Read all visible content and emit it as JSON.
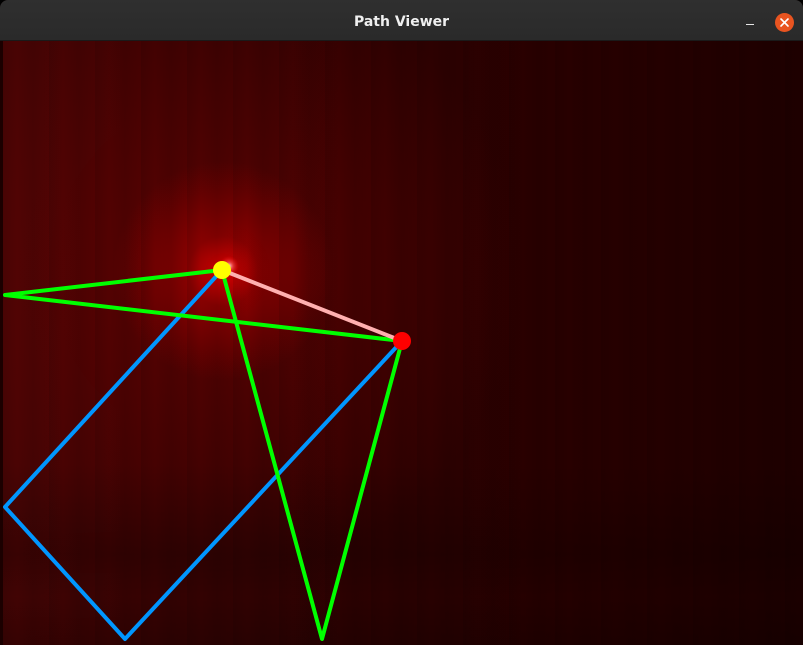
{
  "window": {
    "title": "Path Viewer",
    "minimize_label": "–",
    "close_label": "×"
  },
  "colors": {
    "background": "#2a0000",
    "glow": "#e60000",
    "green_path": "#00ff00",
    "blue_path": "#0096ff",
    "highlight_segment": "#ffb0b0",
    "yellow_marker": "#ffff00",
    "red_marker": "#ff0000",
    "close_button": "#e95420"
  },
  "icons": {
    "minimize": "minimize-icon",
    "close": "close-icon"
  }
}
